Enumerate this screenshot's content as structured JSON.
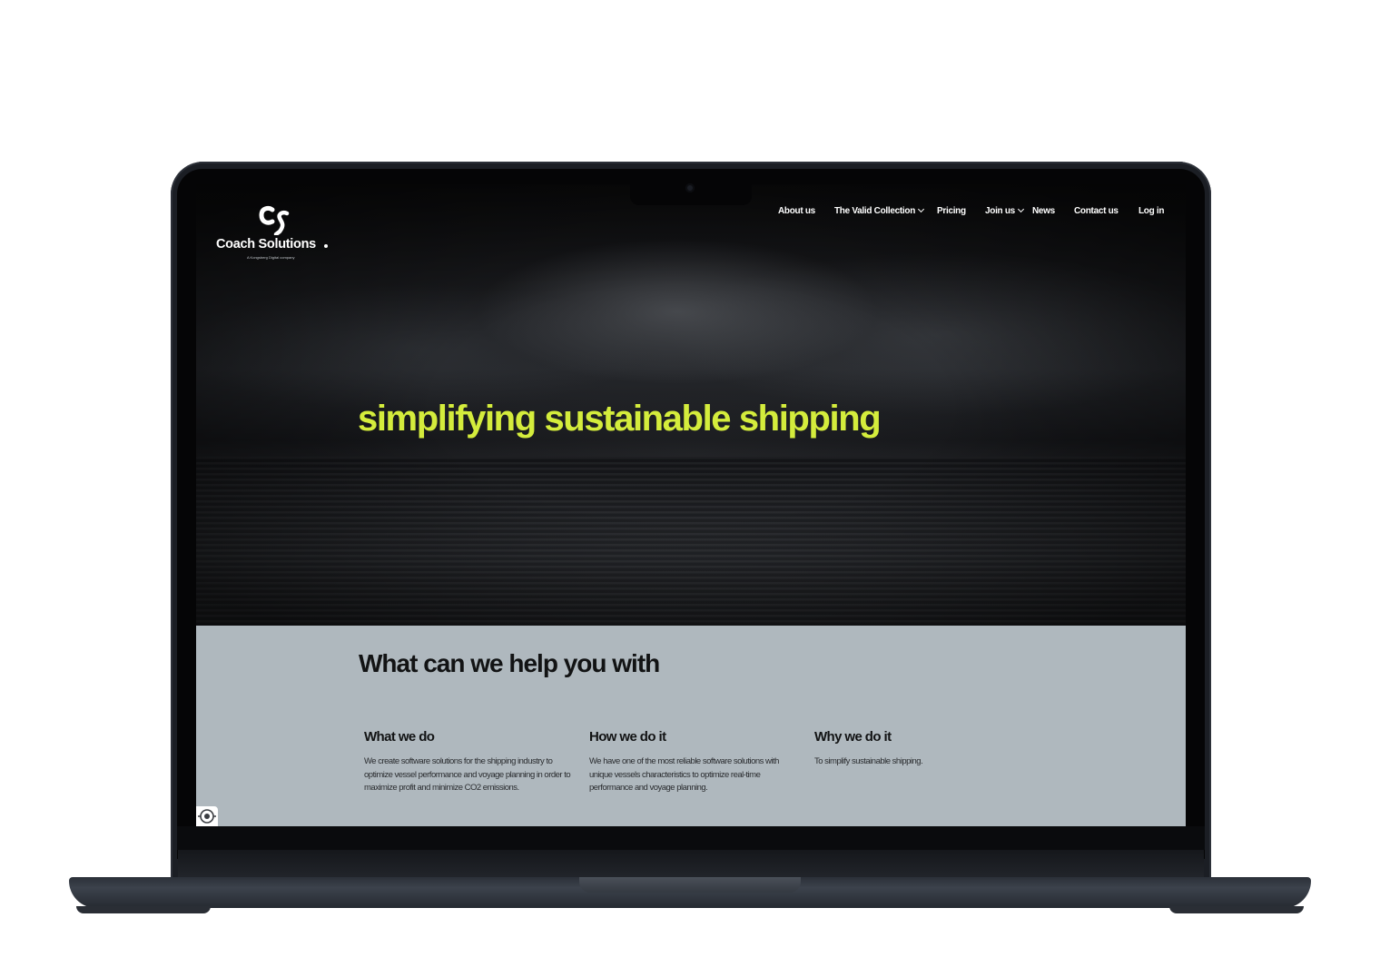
{
  "brand": {
    "name": "Coach Solutions",
    "tagline": "A Kongsberg Digital company"
  },
  "nav": {
    "items": [
      {
        "label": "About us",
        "dropdown": false
      },
      {
        "label": "The Valid Collection",
        "dropdown": true
      },
      {
        "label": "Pricing",
        "dropdown": false
      },
      {
        "label": "Join us",
        "dropdown": true
      },
      {
        "label": "News",
        "dropdown": false
      },
      {
        "label": "Contact us",
        "dropdown": false
      },
      {
        "label": "Log in",
        "dropdown": false
      }
    ]
  },
  "hero": {
    "headline": "simplifying sustainable shipping"
  },
  "help": {
    "title": "What can we help you with",
    "columns": [
      {
        "heading": "What we do",
        "body": "We create software solutions for the shipping industry to optimize vessel performance and voyage planning in order to maximize profit and minimize CO2 emissions."
      },
      {
        "heading": "How we do it",
        "body": "We have one of the most reliable software solutions with unique vessels characteristics to optimize real-time performance and voyage planning."
      },
      {
        "heading": "Why we do it",
        "body": "To simplify sustainable shipping."
      }
    ]
  },
  "colors": {
    "accent": "#d4ec3c",
    "section_bg": "#afb8be"
  },
  "icons": {
    "logo": "coach-solutions-logo-icon",
    "accessibility": "accessibility-icon"
  }
}
